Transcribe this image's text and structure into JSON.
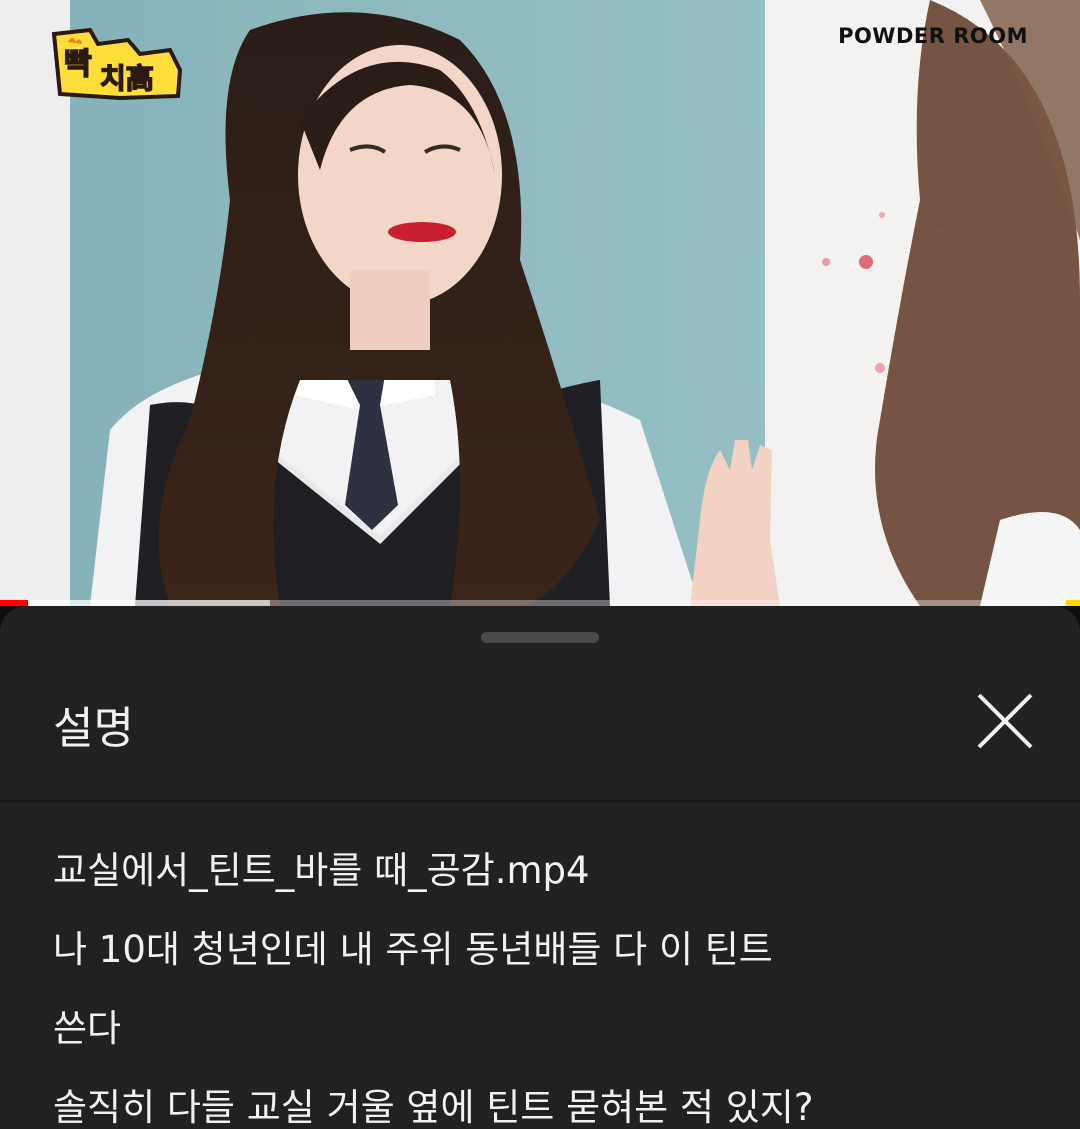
{
  "video": {
    "channel_logo_text": "빡치高",
    "brand_watermark": "POWDER ROOM",
    "progress_fraction": 0.026,
    "buffered_fraction": 0.25
  },
  "description_sheet": {
    "title": "설명",
    "close_icon": "close-icon",
    "lines": [
      "교실에서_틴트_바를 때_공감.mp4",
      "나 10대 청년인데 내 주위 동년배들 다 이 틴트",
      "쓴다",
      "솔직히 다들 교실 거울 옆에 틴트 묻혀본 적 있지?"
    ]
  },
  "colors": {
    "sheet_background": "#212121",
    "text_primary": "#f1f1f1",
    "progress_played": "#ff0000",
    "handle": "#4a4a4a"
  }
}
